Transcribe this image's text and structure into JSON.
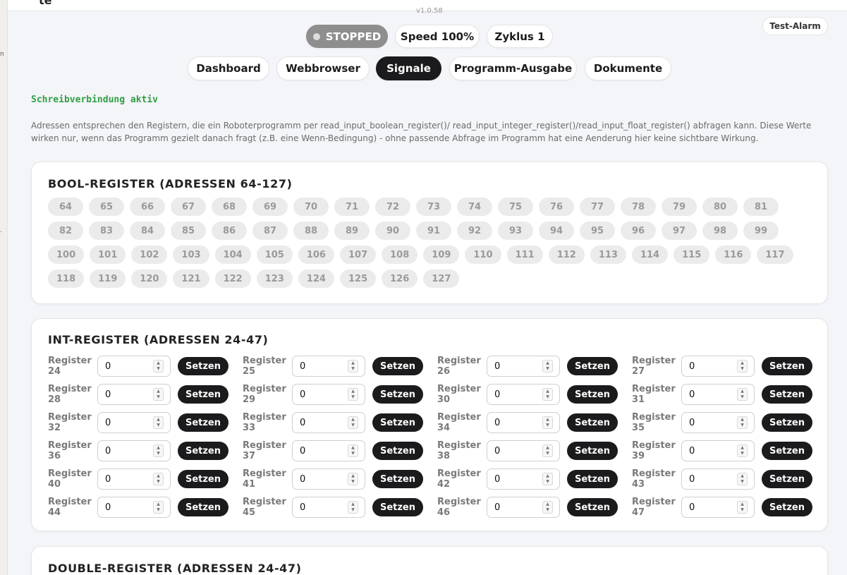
{
  "app": {
    "brand_fragment": "te",
    "version": "v1.0.58"
  },
  "side_labels": [
    "n",
    "."
  ],
  "status": {
    "state": "STOPPED",
    "speed": "Speed 100%",
    "cycle": "Zyklus 1"
  },
  "alarm_label": "Test-Alarm",
  "tabs": [
    "Dashboard",
    "Webbrowser",
    "Signale",
    "Programm-Ausgabe",
    "Dokumente"
  ],
  "active_tab": "Signale",
  "connection_status": "Schreibverbindung aktiv",
  "info_text": "Adressen entsprechen den Registern, die ein Roboterprogramm per read_input_boolean_register()/ read_input_integer_register()/read_input_float_register() abfragen kann. Diese Werte wirken nur, wenn das Programm gezielt danach fragt (z.B. eine Wenn-Bedingung) - ohne passende Abfrage im Programm hat eine Aenderung hier keine sichtbare Wirkung.",
  "bool_section": {
    "title": "BOOL-REGISTER (ADRESSEN 64-127)",
    "addresses": [
      "64",
      "65",
      "66",
      "67",
      "68",
      "69",
      "70",
      "71",
      "72",
      "73",
      "74",
      "75",
      "76",
      "77",
      "78",
      "79",
      "80",
      "81",
      "82",
      "83",
      "84",
      "85",
      "86",
      "87",
      "88",
      "89",
      "90",
      "91",
      "92",
      "93",
      "94",
      "95",
      "96",
      "97",
      "98",
      "99",
      "100",
      "101",
      "102",
      "103",
      "104",
      "105",
      "106",
      "107",
      "108",
      "109",
      "110",
      "111",
      "112",
      "113",
      "114",
      "115",
      "116",
      "117",
      "118",
      "119",
      "120",
      "121",
      "122",
      "123",
      "124",
      "125",
      "126",
      "127"
    ]
  },
  "int_section": {
    "title": "INT-REGISTER (ADRESSEN 24-47)",
    "label_prefix": "Register",
    "button_label": "Setzen",
    "registers": [
      {
        "num": "24",
        "value": "0"
      },
      {
        "num": "25",
        "value": "0"
      },
      {
        "num": "26",
        "value": "0"
      },
      {
        "num": "27",
        "value": "0"
      },
      {
        "num": "28",
        "value": "0"
      },
      {
        "num": "29",
        "value": "0"
      },
      {
        "num": "30",
        "value": "0"
      },
      {
        "num": "31",
        "value": "0"
      },
      {
        "num": "32",
        "value": "0"
      },
      {
        "num": "33",
        "value": "0"
      },
      {
        "num": "34",
        "value": "0"
      },
      {
        "num": "35",
        "value": "0"
      },
      {
        "num": "36",
        "value": "0"
      },
      {
        "num": "37",
        "value": "0"
      },
      {
        "num": "38",
        "value": "0"
      },
      {
        "num": "39",
        "value": "0"
      },
      {
        "num": "40",
        "value": "0"
      },
      {
        "num": "41",
        "value": "0"
      },
      {
        "num": "42",
        "value": "0"
      },
      {
        "num": "43",
        "value": "0"
      },
      {
        "num": "44",
        "value": "0"
      },
      {
        "num": "45",
        "value": "0"
      },
      {
        "num": "46",
        "value": "0"
      },
      {
        "num": "47",
        "value": "0"
      }
    ]
  },
  "double_section": {
    "title": "DOUBLE-REGISTER (ADRESSEN 24-47)"
  }
}
